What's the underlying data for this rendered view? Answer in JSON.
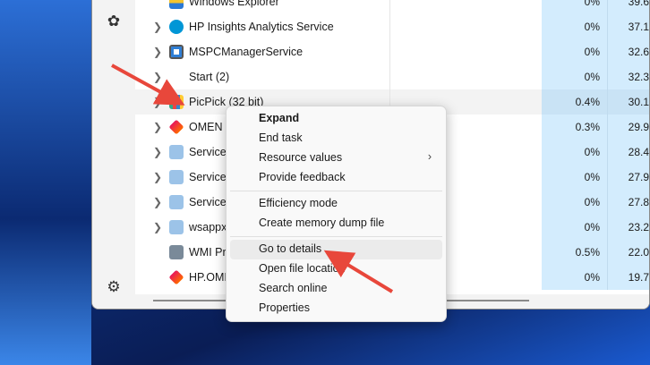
{
  "processes": [
    {
      "name": "Windows Explorer",
      "cpu": "0%",
      "mem": "39.6",
      "icon": "folder-icon",
      "expand": false
    },
    {
      "name": "HP Insights Analytics Service",
      "cpu": "0%",
      "mem": "37.1",
      "icon": "hp-icon",
      "expand": true
    },
    {
      "name": "MSPCManagerService",
      "cpu": "0%",
      "mem": "32.6",
      "icon": "window-app-icon",
      "expand": true
    },
    {
      "name": "Start (2)",
      "cpu": "0%",
      "mem": "32.3",
      "icon": "none",
      "expand": true
    },
    {
      "name": "PicPick (32 bit)",
      "cpu": "0.4%",
      "mem": "30.1",
      "icon": "picpick-icon",
      "expand": true,
      "selected": true
    },
    {
      "name": "OMEN C",
      "cpu": "0.3%",
      "mem": "29.9",
      "icon": "omen-icon",
      "expand": true
    },
    {
      "name": "Service",
      "cpu": "0%",
      "mem": "28.4",
      "icon": "service-gear-icon",
      "expand": true
    },
    {
      "name": "Service",
      "cpu": "0%",
      "mem": "27.9",
      "icon": "service-gear-icon",
      "expand": true
    },
    {
      "name": "Service",
      "cpu": "0%",
      "mem": "27.8",
      "icon": "service-gear-icon",
      "expand": true
    },
    {
      "name": "wsappx",
      "cpu": "0%",
      "mem": "23.2",
      "icon": "service-gear-icon",
      "expand": true
    },
    {
      "name": "WMI Pro",
      "cpu": "0.5%",
      "mem": "22.0",
      "icon": "wmi-icon",
      "expand": false
    },
    {
      "name": "HP.OMI",
      "cpu": "0%",
      "mem": "19.7",
      "icon": "omen-icon",
      "expand": false
    }
  ],
  "context_menu": {
    "items": [
      "Expand",
      "End task",
      "Resource values",
      "Provide feedback",
      "Efficiency mode",
      "Create memory dump file",
      "Go to details",
      "Open file location",
      "Search online",
      "Properties"
    ]
  },
  "colors": {
    "accent_arrow": "#e8473b",
    "cpu_col": "#d3ecfd"
  }
}
